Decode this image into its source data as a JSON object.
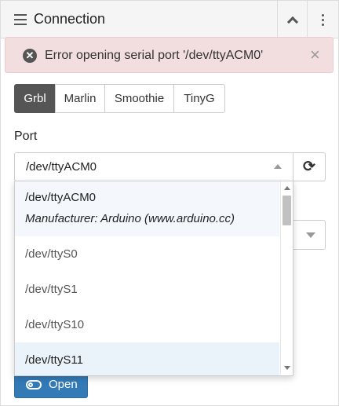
{
  "header": {
    "title": "Connection",
    "menu_icon": "hamburger-icon",
    "collapse_icon": "chevron-up-icon",
    "more_icon": "vertical-ellipsis-icon"
  },
  "alert": {
    "icon": "error-circle-icon",
    "message": "Error opening serial port '/dev/ttyACM0'",
    "close": "×",
    "background": "#f2dede"
  },
  "controllers": [
    {
      "label": "Grbl",
      "active": true
    },
    {
      "label": "Marlin",
      "active": false
    },
    {
      "label": "Smoothie",
      "active": false
    },
    {
      "label": "TinyG",
      "active": false
    }
  ],
  "port": {
    "label": "Port",
    "selected": "/dev/ttyACM0",
    "refresh_icon": "refresh-icon",
    "options": [
      {
        "path": "/dev/ttyACM0",
        "manufacturer": "Manufacturer: Arduino (www.arduino.cc)"
      },
      {
        "path": "/dev/ttyS0"
      },
      {
        "path": "/dev/ttyS1"
      },
      {
        "path": "/dev/ttyS10"
      },
      {
        "path": "/dev/ttyS11"
      }
    ]
  },
  "open_button": {
    "label": "Open",
    "icon": "toggle-off-icon",
    "color": "#337ab7"
  }
}
